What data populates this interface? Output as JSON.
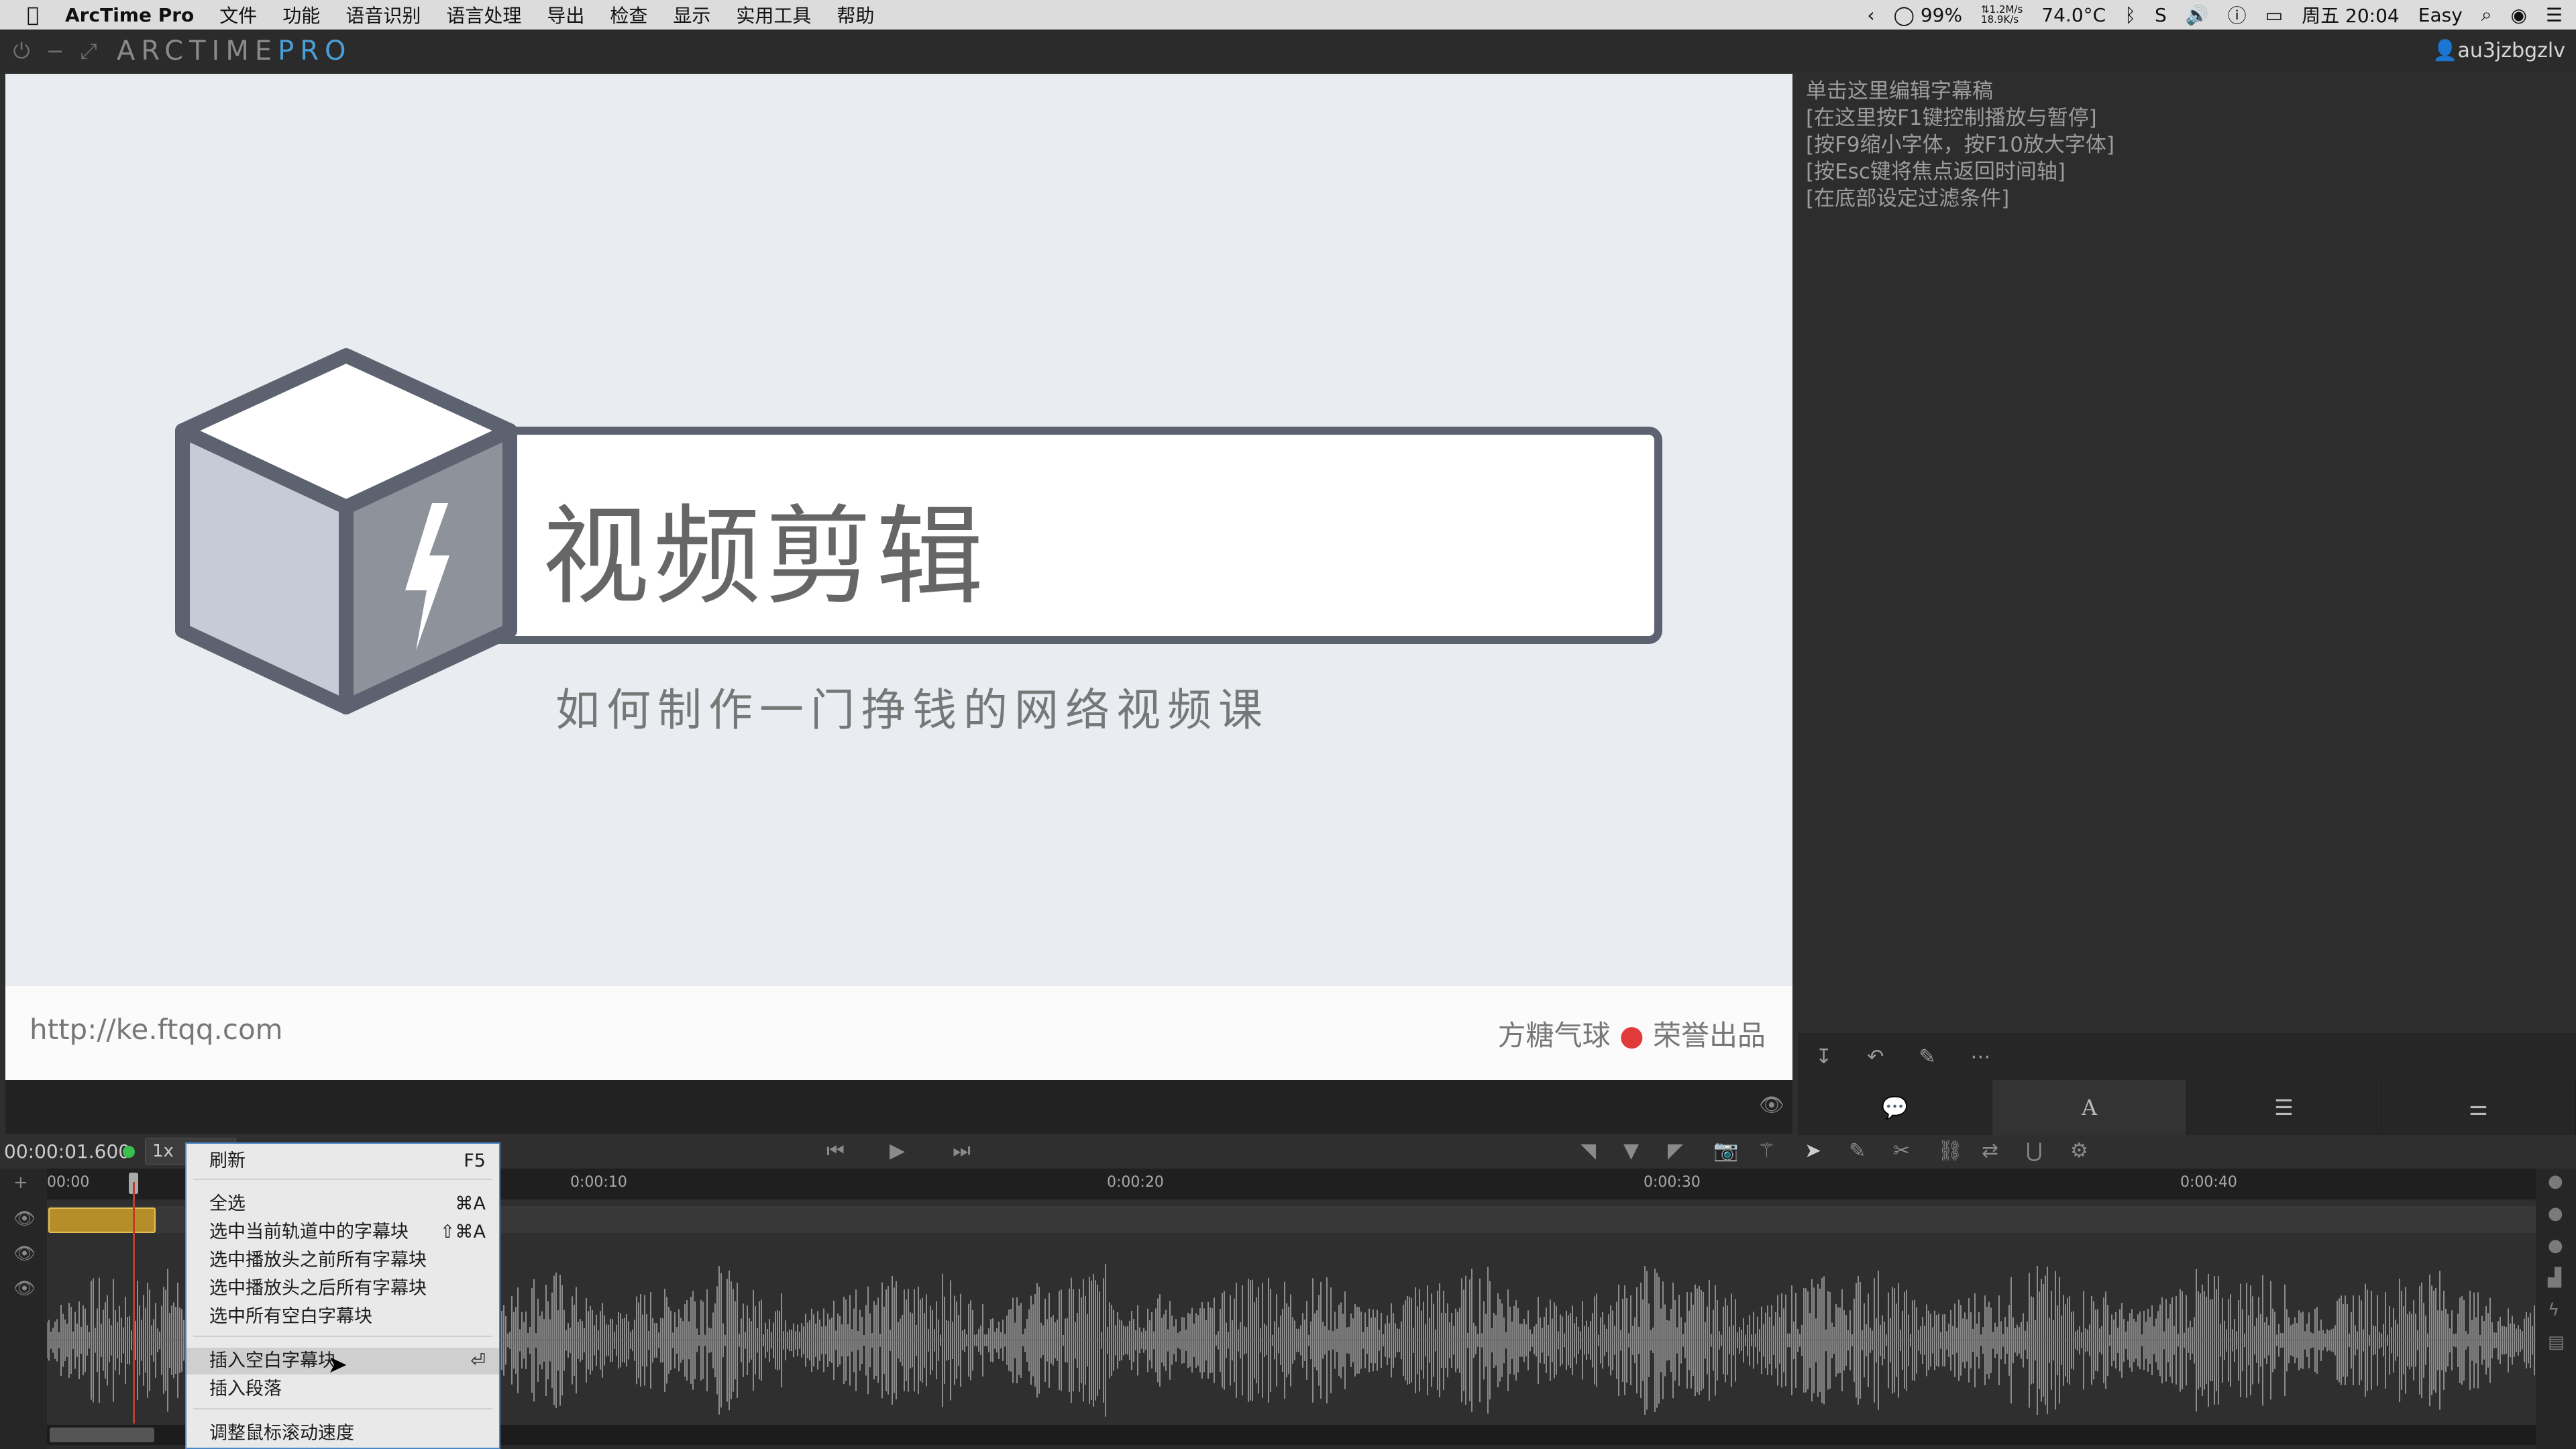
{
  "menubar": {
    "apple_icon": "apple-icon",
    "app_name": "ArcTime Pro",
    "items": [
      "文件",
      "功能",
      "语音识别",
      "语言处理",
      "导出",
      "检查",
      "显示",
      "实用工具",
      "帮助"
    ],
    "status": {
      "battery": "99%",
      "net_up": "1.2M/s",
      "net_down": "18.9K/s",
      "temp": "74.0°C",
      "clock": "周五 20:04",
      "input_method": "Easy"
    }
  },
  "titlebar": {
    "logo_main": "ARCTIME",
    "logo_accent": "PRO",
    "user": "au3jzbgzlv"
  },
  "preview": {
    "title": "视频剪辑",
    "subtitle": "如何制作一门挣钱的网络视频课",
    "url": "http://ke.ftqq.com",
    "credit_left": "方糖气球",
    "credit_right": "荣誉出品",
    "accent": "#5d6270"
  },
  "script_panel": {
    "lines": [
      "单击这里编辑字幕稿",
      "[在这里按F1键控制播放与暂停]",
      "[按F9缩小字体，按F10放大字体]",
      "[按Esc键将焦点返回时间轴]",
      "[在底部设定过滤条件]"
    ]
  },
  "transport": {
    "time": "00:00:01.600",
    "speed": "1x"
  },
  "timeline": {
    "ticks": [
      "00:00",
      "0:00:10",
      "0:00:20",
      "0:00:30",
      "0:00:40"
    ]
  },
  "context_menu": {
    "refresh": {
      "label": "刷新",
      "shortcut": "F5"
    },
    "select_all": {
      "label": "全选",
      "shortcut": "⌘A"
    },
    "select_track": {
      "label": "选中当前轨道中的字幕块",
      "shortcut": "⇧⌘A"
    },
    "select_before": {
      "label": "选中播放头之前所有字幕块"
    },
    "select_after": {
      "label": "选中播放头之后所有字幕块"
    },
    "select_empty": {
      "label": "选中所有空白字幕块"
    },
    "insert_empty": {
      "label": "插入空白字幕块",
      "shortcut": "⏎"
    },
    "insert_paragraph": {
      "label": "插入段落"
    },
    "scroll_speed": {
      "label": "调整鼠标滚动速度"
    }
  }
}
